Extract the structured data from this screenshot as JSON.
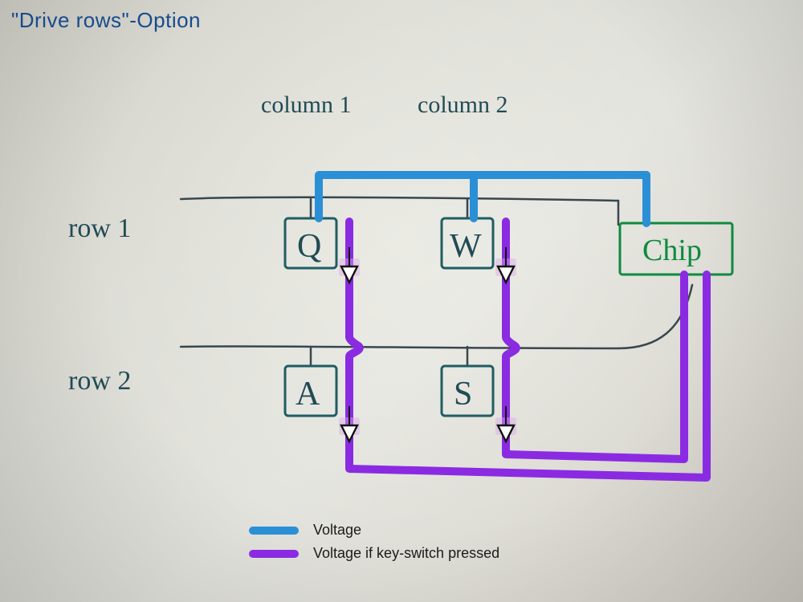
{
  "title": "\"Drive rows\"-Option",
  "labels": {
    "column1": "column 1",
    "column2": "column 2",
    "row1": "row 1",
    "row2": "row 2",
    "chip": "Chip"
  },
  "keys": {
    "Q": "Q",
    "W": "W",
    "A": "A",
    "S": "S"
  },
  "legend": {
    "voltage": "Voltage",
    "voltageIfPressed": "Voltage if key-switch pressed"
  },
  "colors": {
    "voltage": "#2b8fd6",
    "voltageIfPressed": "#8a2be2",
    "pen": "#214b55",
    "chip": "#0f8a3f",
    "title": "#184a8c"
  },
  "chart_data": {
    "type": "table",
    "description": "Keyboard matrix scan diagram, drive-rows option",
    "columns": [
      "column 1",
      "column 2"
    ],
    "rows": [
      "row 1",
      "row 2"
    ],
    "cells": [
      [
        "Q",
        "W"
      ],
      [
        "A",
        "S"
      ]
    ],
    "controller": "Chip",
    "signals": [
      {
        "name": "Voltage",
        "color": "#2b8fd6",
        "driven_from": "Chip",
        "along": "row 1"
      },
      {
        "name": "Voltage if key-switch pressed",
        "color": "#8a2be2",
        "through": "diodes on columns",
        "read_by": "Chip"
      }
    ],
    "diodes_between_rows": true
  }
}
